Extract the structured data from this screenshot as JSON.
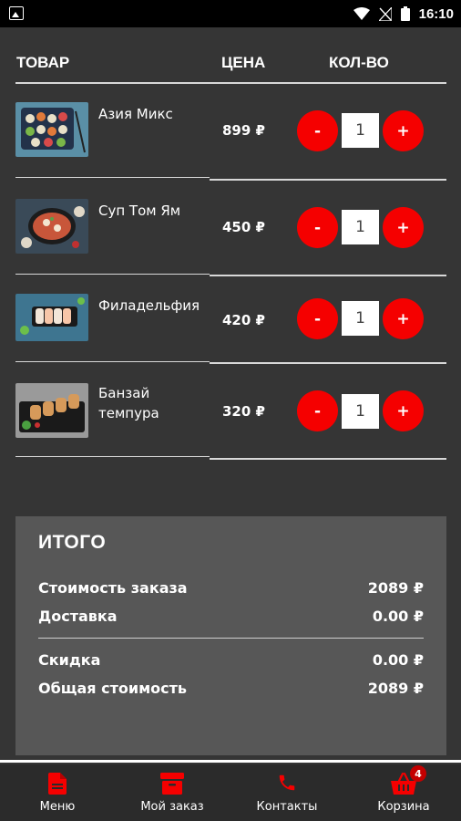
{
  "status_bar": {
    "time": "16:10"
  },
  "table": {
    "headers": {
      "item": "ТОВАР",
      "price": "ЦЕНА",
      "qty": "КОЛ-ВО"
    },
    "rows": [
      {
        "name": "Азия Микс",
        "price": "899 ₽",
        "qty": "1",
        "minus": "-",
        "plus": "+"
      },
      {
        "name": "Суп Том Ям",
        "price": "450 ₽",
        "qty": "1",
        "minus": "-",
        "plus": "+"
      },
      {
        "name": "Филадельфия",
        "price": "420 ₽",
        "qty": "1",
        "minus": "-",
        "plus": "+"
      },
      {
        "name": "Банзай темпура",
        "price": "320 ₽",
        "qty": "1",
        "minus": "-",
        "plus": "+"
      }
    ]
  },
  "totals": {
    "title": "ИТОГО",
    "order_cost_label": "Стоимость заказа",
    "order_cost_value": "2089 ₽",
    "delivery_label": "Доставка",
    "delivery_value": "0.00 ₽",
    "discount_label": "Скидка",
    "discount_value": "0.00 ₽",
    "total_label": "Общая стоимость",
    "total_value": "2089 ₽"
  },
  "nav": {
    "items": [
      {
        "label": "Меню",
        "icon": "document-icon"
      },
      {
        "label": "Мой заказ",
        "icon": "archive-box-icon"
      },
      {
        "label": "Контакты",
        "icon": "phone-icon"
      },
      {
        "label": "Корзина",
        "icon": "basket-icon"
      }
    ],
    "cart_badge": "4"
  },
  "colors": {
    "accent": "#f50000",
    "background": "#353535",
    "panel": "#575757",
    "navbar": "#2b2b2b"
  }
}
